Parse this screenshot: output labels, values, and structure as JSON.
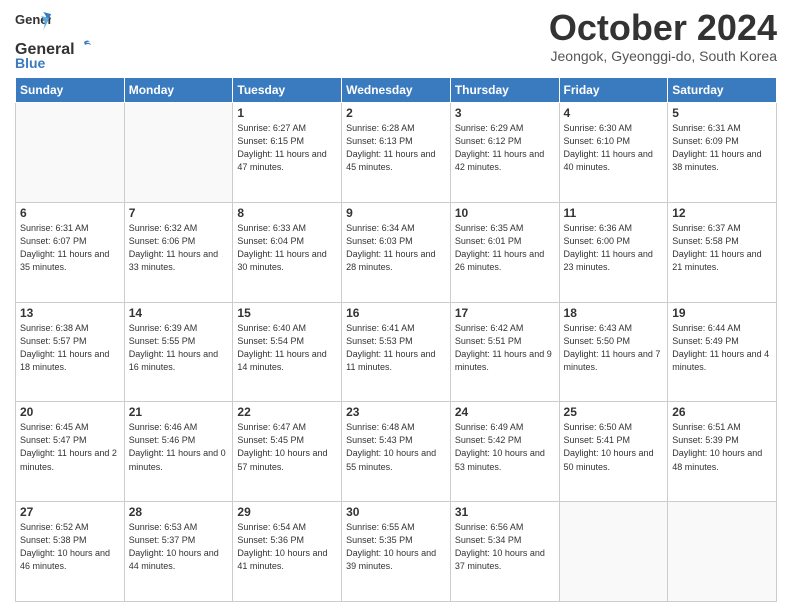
{
  "header": {
    "logo_general": "General",
    "logo_blue": "Blue",
    "month": "October 2024",
    "location": "Jeongok, Gyeonggi-do, South Korea"
  },
  "days_of_week": [
    "Sunday",
    "Monday",
    "Tuesday",
    "Wednesday",
    "Thursday",
    "Friday",
    "Saturday"
  ],
  "weeks": [
    [
      {
        "day": "",
        "sunrise": "",
        "sunset": "",
        "daylight": ""
      },
      {
        "day": "",
        "sunrise": "",
        "sunset": "",
        "daylight": ""
      },
      {
        "day": "1",
        "sunrise": "Sunrise: 6:27 AM",
        "sunset": "Sunset: 6:15 PM",
        "daylight": "Daylight: 11 hours and 47 minutes."
      },
      {
        "day": "2",
        "sunrise": "Sunrise: 6:28 AM",
        "sunset": "Sunset: 6:13 PM",
        "daylight": "Daylight: 11 hours and 45 minutes."
      },
      {
        "day": "3",
        "sunrise": "Sunrise: 6:29 AM",
        "sunset": "Sunset: 6:12 PM",
        "daylight": "Daylight: 11 hours and 42 minutes."
      },
      {
        "day": "4",
        "sunrise": "Sunrise: 6:30 AM",
        "sunset": "Sunset: 6:10 PM",
        "daylight": "Daylight: 11 hours and 40 minutes."
      },
      {
        "day": "5",
        "sunrise": "Sunrise: 6:31 AM",
        "sunset": "Sunset: 6:09 PM",
        "daylight": "Daylight: 11 hours and 38 minutes."
      }
    ],
    [
      {
        "day": "6",
        "sunrise": "Sunrise: 6:31 AM",
        "sunset": "Sunset: 6:07 PM",
        "daylight": "Daylight: 11 hours and 35 minutes."
      },
      {
        "day": "7",
        "sunrise": "Sunrise: 6:32 AM",
        "sunset": "Sunset: 6:06 PM",
        "daylight": "Daylight: 11 hours and 33 minutes."
      },
      {
        "day": "8",
        "sunrise": "Sunrise: 6:33 AM",
        "sunset": "Sunset: 6:04 PM",
        "daylight": "Daylight: 11 hours and 30 minutes."
      },
      {
        "day": "9",
        "sunrise": "Sunrise: 6:34 AM",
        "sunset": "Sunset: 6:03 PM",
        "daylight": "Daylight: 11 hours and 28 minutes."
      },
      {
        "day": "10",
        "sunrise": "Sunrise: 6:35 AM",
        "sunset": "Sunset: 6:01 PM",
        "daylight": "Daylight: 11 hours and 26 minutes."
      },
      {
        "day": "11",
        "sunrise": "Sunrise: 6:36 AM",
        "sunset": "Sunset: 6:00 PM",
        "daylight": "Daylight: 11 hours and 23 minutes."
      },
      {
        "day": "12",
        "sunrise": "Sunrise: 6:37 AM",
        "sunset": "Sunset: 5:58 PM",
        "daylight": "Daylight: 11 hours and 21 minutes."
      }
    ],
    [
      {
        "day": "13",
        "sunrise": "Sunrise: 6:38 AM",
        "sunset": "Sunset: 5:57 PM",
        "daylight": "Daylight: 11 hours and 18 minutes."
      },
      {
        "day": "14",
        "sunrise": "Sunrise: 6:39 AM",
        "sunset": "Sunset: 5:55 PM",
        "daylight": "Daylight: 11 hours and 16 minutes."
      },
      {
        "day": "15",
        "sunrise": "Sunrise: 6:40 AM",
        "sunset": "Sunset: 5:54 PM",
        "daylight": "Daylight: 11 hours and 14 minutes."
      },
      {
        "day": "16",
        "sunrise": "Sunrise: 6:41 AM",
        "sunset": "Sunset: 5:53 PM",
        "daylight": "Daylight: 11 hours and 11 minutes."
      },
      {
        "day": "17",
        "sunrise": "Sunrise: 6:42 AM",
        "sunset": "Sunset: 5:51 PM",
        "daylight": "Daylight: 11 hours and 9 minutes."
      },
      {
        "day": "18",
        "sunrise": "Sunrise: 6:43 AM",
        "sunset": "Sunset: 5:50 PM",
        "daylight": "Daylight: 11 hours and 7 minutes."
      },
      {
        "day": "19",
        "sunrise": "Sunrise: 6:44 AM",
        "sunset": "Sunset: 5:49 PM",
        "daylight": "Daylight: 11 hours and 4 minutes."
      }
    ],
    [
      {
        "day": "20",
        "sunrise": "Sunrise: 6:45 AM",
        "sunset": "Sunset: 5:47 PM",
        "daylight": "Daylight: 11 hours and 2 minutes."
      },
      {
        "day": "21",
        "sunrise": "Sunrise: 6:46 AM",
        "sunset": "Sunset: 5:46 PM",
        "daylight": "Daylight: 11 hours and 0 minutes."
      },
      {
        "day": "22",
        "sunrise": "Sunrise: 6:47 AM",
        "sunset": "Sunset: 5:45 PM",
        "daylight": "Daylight: 10 hours and 57 minutes."
      },
      {
        "day": "23",
        "sunrise": "Sunrise: 6:48 AM",
        "sunset": "Sunset: 5:43 PM",
        "daylight": "Daylight: 10 hours and 55 minutes."
      },
      {
        "day": "24",
        "sunrise": "Sunrise: 6:49 AM",
        "sunset": "Sunset: 5:42 PM",
        "daylight": "Daylight: 10 hours and 53 minutes."
      },
      {
        "day": "25",
        "sunrise": "Sunrise: 6:50 AM",
        "sunset": "Sunset: 5:41 PM",
        "daylight": "Daylight: 10 hours and 50 minutes."
      },
      {
        "day": "26",
        "sunrise": "Sunrise: 6:51 AM",
        "sunset": "Sunset: 5:39 PM",
        "daylight": "Daylight: 10 hours and 48 minutes."
      }
    ],
    [
      {
        "day": "27",
        "sunrise": "Sunrise: 6:52 AM",
        "sunset": "Sunset: 5:38 PM",
        "daylight": "Daylight: 10 hours and 46 minutes."
      },
      {
        "day": "28",
        "sunrise": "Sunrise: 6:53 AM",
        "sunset": "Sunset: 5:37 PM",
        "daylight": "Daylight: 10 hours and 44 minutes."
      },
      {
        "day": "29",
        "sunrise": "Sunrise: 6:54 AM",
        "sunset": "Sunset: 5:36 PM",
        "daylight": "Daylight: 10 hours and 41 minutes."
      },
      {
        "day": "30",
        "sunrise": "Sunrise: 6:55 AM",
        "sunset": "Sunset: 5:35 PM",
        "daylight": "Daylight: 10 hours and 39 minutes."
      },
      {
        "day": "31",
        "sunrise": "Sunrise: 6:56 AM",
        "sunset": "Sunset: 5:34 PM",
        "daylight": "Daylight: 10 hours and 37 minutes."
      },
      {
        "day": "",
        "sunrise": "",
        "sunset": "",
        "daylight": ""
      },
      {
        "day": "",
        "sunrise": "",
        "sunset": "",
        "daylight": ""
      }
    ]
  ]
}
